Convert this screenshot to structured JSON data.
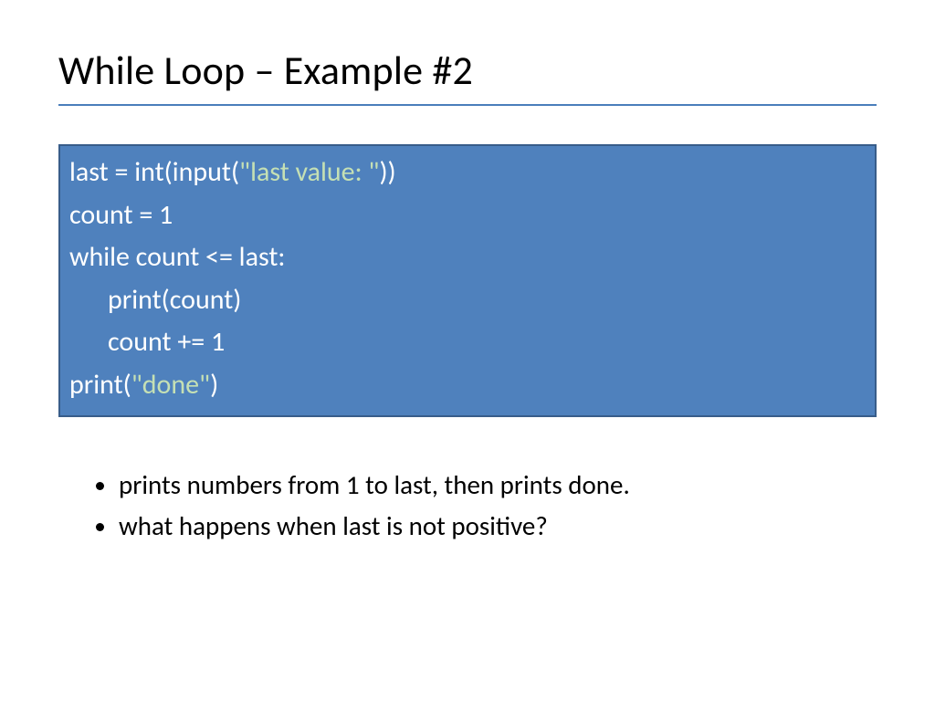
{
  "title": "While Loop – Example #2",
  "code": {
    "l1a": "last = int(input(",
    "l1b": "\"last value: \"",
    "l1c": "))",
    "l2": "count = 1",
    "l3": "while count <= last:",
    "l4": "print(count)",
    "l5": "count += 1",
    "l6a": "print(",
    "l6b": "\"done\"",
    "l6c": ")"
  },
  "bullets": {
    "b1": "prints numbers from 1 to last, then prints done.",
    "b2": "what happens when last is not positive?"
  }
}
